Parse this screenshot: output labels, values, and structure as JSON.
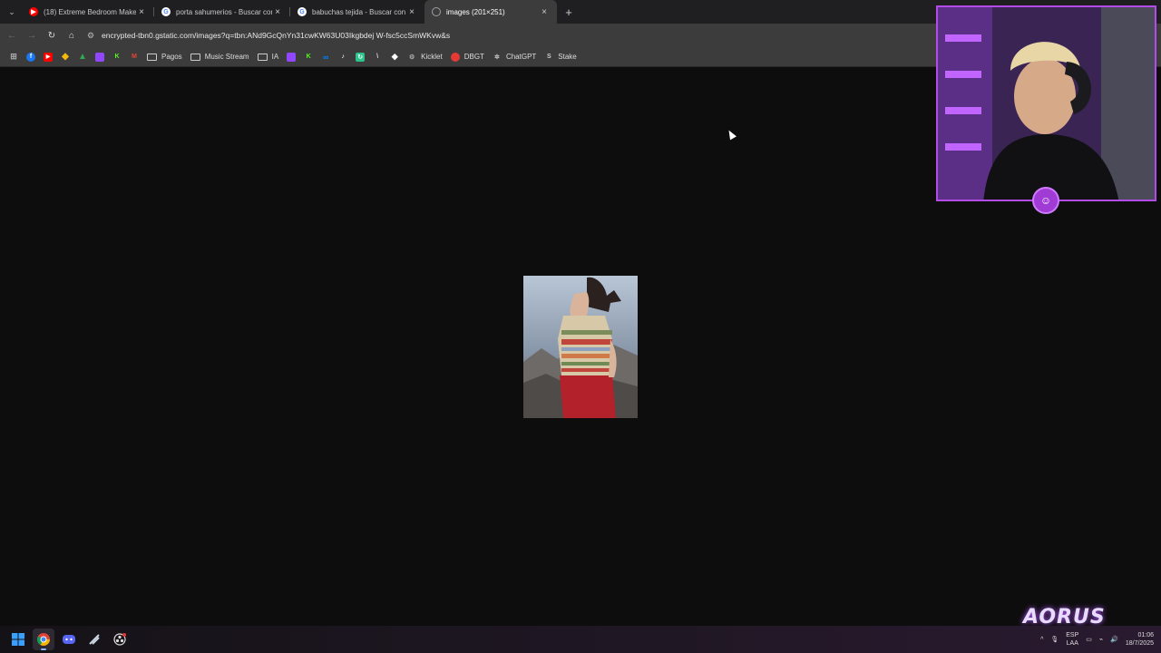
{
  "browser": {
    "tabs": [
      {
        "title": "(18) Extreme Bedroom Makeov",
        "favicon": "youtube-icon",
        "color": "#ff0000",
        "active": false
      },
      {
        "title": "porta sahumerios - Buscar con",
        "favicon": "google-icon",
        "color": "#ffffff",
        "active": false
      },
      {
        "title": "babuchas tejida - Buscar con G",
        "favicon": "google-icon",
        "color": "#ffffff",
        "active": false
      },
      {
        "title": "images (201×251)",
        "favicon": "globe-icon",
        "color": "#9aa0a6",
        "active": true
      }
    ],
    "new_tab_label": "+",
    "close_glyph": "×",
    "url": "encrypted-tbn0.gstatic.com/images?q=tbn:ANd9GcQnYn31cwKW63U03Ikgbdej W-fsc5ccSmWKvw&s",
    "bookmarks": [
      {
        "label": "",
        "icon": "apps-grid-icon",
        "color": "#aaaaaa"
      },
      {
        "label": "",
        "icon": "facebook-icon",
        "color": "#1877f2"
      },
      {
        "label": "",
        "icon": "youtube-icon",
        "color": "#ff0000"
      },
      {
        "label": "",
        "icon": "binance-icon",
        "color": "#f0b90b"
      },
      {
        "label": "",
        "icon": "drive-icon",
        "color": "#34a853"
      },
      {
        "label": "",
        "icon": "twitch-icon",
        "color": "#9146ff"
      },
      {
        "label": "",
        "icon": "kick-icon",
        "color": "#53fc18"
      },
      {
        "label": "",
        "icon": "gmail-icon",
        "color": "#ea4335"
      },
      {
        "label": "Pagos",
        "icon": "folder-icon",
        "color": "#cccccc"
      },
      {
        "label": "Music Stream",
        "icon": "folder-icon",
        "color": "#cccccc"
      },
      {
        "label": "IA",
        "icon": "folder-icon",
        "color": "#cccccc"
      },
      {
        "label": "",
        "icon": "twitch-icon",
        "color": "#9146ff"
      },
      {
        "label": "",
        "icon": "kick-icon",
        "color": "#53fc18"
      },
      {
        "label": "",
        "icon": "meta-icon",
        "color": "#0081fb"
      },
      {
        "label": "",
        "icon": "tiktok-icon",
        "color": "#ffffff"
      },
      {
        "label": "",
        "icon": "refresh-app-icon",
        "color": "#2bc48a"
      },
      {
        "label": "",
        "icon": "v-icon",
        "color": "#dddddd"
      },
      {
        "label": "",
        "icon": "diamond-icon",
        "color": "#ffffff"
      },
      {
        "label": "Kicklet",
        "icon": "kicklet-icon",
        "color": "#aaaaaa"
      },
      {
        "label": "DBGT",
        "icon": "dbgt-icon",
        "color": "#e53935"
      },
      {
        "label": "ChatGPT",
        "icon": "chatgpt-icon",
        "color": "#cccccc"
      },
      {
        "label": "Stake",
        "icon": "stake-icon",
        "color": "#cccccc"
      }
    ]
  },
  "page": {
    "background": "#0e0d0e",
    "image_alt": "woman in striped knit top"
  },
  "overlay": {
    "webcam_border": "#b34be8",
    "brand": "AORUS"
  },
  "taskbar": {
    "icons": [
      "windows-start-icon",
      "chrome-icon",
      "discord-icon",
      "steam-icon",
      "obs-icon"
    ],
    "tray_lang": "ESP",
    "tray_layout": "LAA",
    "time": "01:06",
    "date": "18/7/2025"
  }
}
